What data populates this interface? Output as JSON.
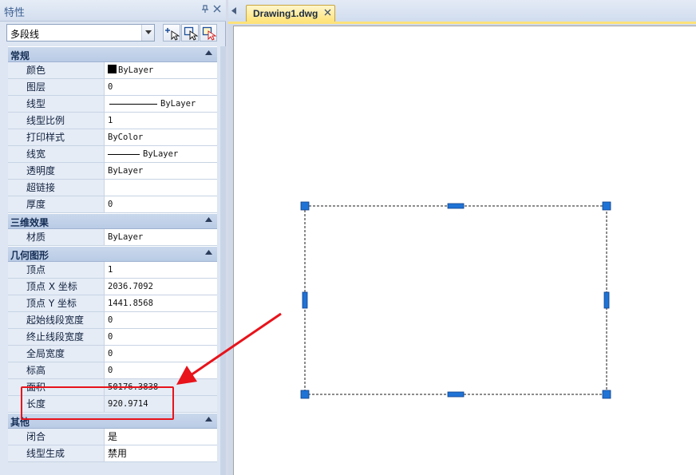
{
  "palette": {
    "title": "特性",
    "buttons": {
      "pin": "ᵖ",
      "close": "✕"
    },
    "selector": {
      "value": "多段线"
    },
    "tool_buttons": [
      "quick-select",
      "select-objects",
      "toggle-pickadd"
    ]
  },
  "sections": {
    "general": {
      "label": "常规",
      "rows": [
        {
          "name": "颜色",
          "value": "ByLayer"
        },
        {
          "name": "图层",
          "value": "0"
        },
        {
          "name": "线型",
          "value": "ByLayer"
        },
        {
          "name": "线型比例",
          "value": "1"
        },
        {
          "name": "打印样式",
          "value": "ByColor"
        },
        {
          "name": "线宽",
          "value": "ByLayer"
        },
        {
          "name": "透明度",
          "value": "ByLayer"
        },
        {
          "name": "超链接",
          "value": ""
        },
        {
          "name": "厚度",
          "value": "0"
        }
      ]
    },
    "effects3d": {
      "label": "三维效果",
      "rows": [
        {
          "name": "材质",
          "value": "ByLayer"
        }
      ]
    },
    "geometry": {
      "label": "几何图形",
      "rows": [
        {
          "name": "顶点",
          "value": "1"
        },
        {
          "name": "顶点 X 坐标",
          "value": "2036.7092"
        },
        {
          "name": "顶点 Y 坐标",
          "value": "1441.8568"
        },
        {
          "name": "起始线段宽度",
          "value": "0"
        },
        {
          "name": "终止线段宽度",
          "value": "0"
        },
        {
          "name": "全局宽度",
          "value": "0"
        },
        {
          "name": "标高",
          "value": "0"
        },
        {
          "name": "面积",
          "value": "50176.3838"
        },
        {
          "name": "长度",
          "value": "920.9714"
        }
      ]
    },
    "misc": {
      "label": "其他",
      "rows": [
        {
          "name": "闭合",
          "value": "是"
        },
        {
          "name": "线型生成",
          "value": "禁用"
        }
      ]
    }
  },
  "document_tab": {
    "label": "Drawing1.dwg"
  },
  "colors": {
    "grip": "#1f73d6",
    "annotation": "#e8131b",
    "tab_active": "#ffe37a"
  }
}
